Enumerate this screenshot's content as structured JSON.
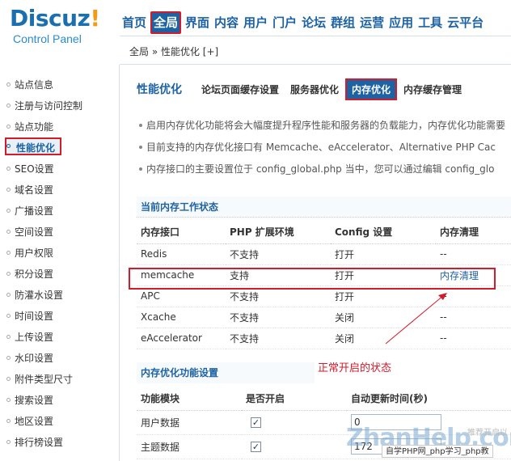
{
  "logo": {
    "brand": "Discuz",
    "bang": "!",
    "sub": "Control Panel"
  },
  "topnav": [
    "首页",
    "全局",
    "界面",
    "内容",
    "用户",
    "门户",
    "论坛",
    "群组",
    "运营",
    "应用",
    "工具",
    "云平台"
  ],
  "breadcrumb": "全局 » 性能优化  [+]",
  "sidebar": [
    "站点信息",
    "注册与访问控制",
    "站点功能",
    "性能优化",
    "SEO设置",
    "域名设置",
    "广播设置",
    "空间设置",
    "用户权限",
    "积分设置",
    "防灌水设置",
    "时间设置",
    "上传设置",
    "水印设置",
    "附件类型尺寸",
    "搜索设置",
    "地区设置",
    "排行榜设置"
  ],
  "tabs": {
    "title": "性能优化",
    "items": [
      "论坛页面缓存设置",
      "服务器优化",
      "内存优化",
      "内存缓存管理"
    ]
  },
  "tips": [
    "启用内存优化功能将会大幅度提升程序性能和服务器的负载能力，内存优化功能需要",
    "目前支持的内存优化接口有 Memcache、eAccelerator、Alternative PHP Cac",
    "内存接口的主要设置位于 config_global.php 当中，您可以通过编辑 config_glo"
  ],
  "status": {
    "title": "当前内存工作状态",
    "headers": [
      "内存接口",
      "PHP 扩展环境",
      "Config 设置",
      "内存清理"
    ],
    "rows": [
      [
        "Redis",
        "不支持",
        "打开",
        "--"
      ],
      [
        "memcache",
        "支持",
        "打开",
        "内存清理"
      ],
      [
        "APC",
        "不支持",
        "打开",
        "--"
      ],
      [
        "Xcache",
        "不支持",
        "关闭",
        "--"
      ],
      [
        "eAccelerator",
        "不支持",
        "关闭",
        "--"
      ]
    ]
  },
  "annotation": "正常开启的状态",
  "features": {
    "title": "内存优化功能设置",
    "headers": [
      "功能模块",
      "是否开启",
      "自动更新时间(秒)"
    ],
    "rows": [
      {
        "name": "用户数据",
        "checked": "✓",
        "value": "0"
      },
      {
        "name": "主题数据",
        "checked": "✓",
        "value": "172"
      }
    ]
  },
  "watermark": {
    "big": "ZhanHelp.com",
    "tag": "自学PHP网_php学习_php教",
    "small": "推荐开启以"
  },
  "colors": {
    "accent": "#1d62a3",
    "highlight": "#d31b2a"
  }
}
